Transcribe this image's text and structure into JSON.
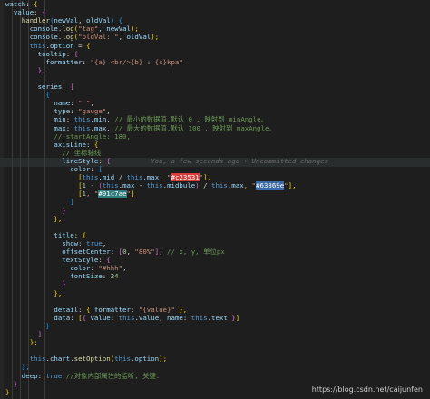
{
  "lines": [
    [
      [
        "watch",
        "tok-key"
      ],
      [
        ": ",
        "tok-plain"
      ],
      [
        "{",
        "tok-br"
      ]
    ],
    [
      [
        "  value",
        "tok-key"
      ],
      [
        ": ",
        "tok-plain"
      ],
      [
        "{",
        "tok-br2"
      ]
    ],
    [
      [
        "    handler",
        "tok-fn"
      ],
      [
        "(",
        "tok-br3"
      ],
      [
        "newVal",
        "tok-key"
      ],
      [
        ", ",
        "tok-plain"
      ],
      [
        "oldVal",
        "tok-key"
      ],
      [
        ") ",
        "tok-br3"
      ],
      [
        "{",
        "tok-br3"
      ]
    ],
    [
      [
        "      console",
        "tok-key"
      ],
      [
        ".",
        "tok-plain"
      ],
      [
        "log",
        "tok-fn"
      ],
      [
        "(",
        "tok-br"
      ],
      [
        "\"tag\"",
        "tok-str"
      ],
      [
        ", newVal",
        "tok-key"
      ],
      [
        ");",
        "tok-br"
      ]
    ],
    [
      [
        "      console",
        "tok-key"
      ],
      [
        ".",
        "tok-plain"
      ],
      [
        "log",
        "tok-fn"
      ],
      [
        "(",
        "tok-br"
      ],
      [
        "\"oldVal: \"",
        "tok-str"
      ],
      [
        ", oldVal",
        "tok-key"
      ],
      [
        ");",
        "tok-br"
      ]
    ],
    [
      [
        "      this",
        "tok-this"
      ],
      [
        ".",
        "tok-plain"
      ],
      [
        "option",
        "tok-key"
      ],
      [
        " = ",
        "tok-plain"
      ],
      [
        "{",
        "tok-br"
      ]
    ],
    [
      [
        "        tooltip",
        "tok-key"
      ],
      [
        ": ",
        "tok-plain"
      ],
      [
        "{",
        "tok-br2"
      ]
    ],
    [
      [
        "          formatter",
        "tok-key"
      ],
      [
        ": ",
        "tok-plain"
      ],
      [
        "\"{a} <br/>{b} : {c}kpa\"",
        "tok-str"
      ]
    ],
    [
      [
        "        },",
        "tok-br2"
      ]
    ],
    [
      [
        "",
        "tok-plain"
      ]
    ],
    [
      [
        "        series",
        "tok-key"
      ],
      [
        ": ",
        "tok-plain"
      ],
      [
        "[",
        "tok-br2"
      ]
    ],
    [
      [
        "          {",
        "tok-br3"
      ]
    ],
    [
      [
        "            name",
        "tok-key"
      ],
      [
        ": ",
        "tok-plain"
      ],
      [
        "\" \"",
        "tok-str"
      ],
      [
        ",",
        "tok-plain"
      ]
    ],
    [
      [
        "            type",
        "tok-key"
      ],
      [
        ": ",
        "tok-plain"
      ],
      [
        "\"gauge\"",
        "tok-str"
      ],
      [
        ",",
        "tok-plain"
      ]
    ],
    [
      [
        "            min",
        "tok-key"
      ],
      [
        ": ",
        "tok-plain"
      ],
      [
        "this",
        "tok-this"
      ],
      [
        ".",
        "tok-plain"
      ],
      [
        "min",
        "tok-key"
      ],
      [
        ", ",
        "tok-plain"
      ],
      [
        "// 最小的数据值,默认 0 . 映射到 minAngle。",
        "tok-cmt"
      ]
    ],
    [
      [
        "            max",
        "tok-key"
      ],
      [
        ": ",
        "tok-plain"
      ],
      [
        "this",
        "tok-this"
      ],
      [
        ".",
        "tok-plain"
      ],
      [
        "max",
        "tok-key"
      ],
      [
        ", ",
        "tok-plain"
      ],
      [
        "// 最大的数据值,默认 100 . 映射到 maxAngle。",
        "tok-cmt"
      ]
    ],
    [
      [
        "            //-startAngle: 180,",
        "tok-cmt"
      ]
    ],
    [
      [
        "            axisLine",
        "tok-key"
      ],
      [
        ": ",
        "tok-plain"
      ],
      [
        "{",
        "tok-br"
      ]
    ],
    [
      [
        "              // 坐标轴线",
        "tok-cmt"
      ]
    ],
    [
      [
        "              lineStyle",
        "tok-key"
      ],
      [
        ": ",
        "tok-plain"
      ],
      [
        "{",
        "tok-br2"
      ],
      [
        "          You, a few seconds ago • Uncommitted changes",
        "tok-ghost"
      ]
    ],
    [
      [
        "                color",
        "tok-key"
      ],
      [
        ": ",
        "tok-plain"
      ],
      [
        "[",
        "tok-br3"
      ]
    ],
    [
      [
        "                  [",
        "tok-br"
      ],
      [
        "this",
        "tok-this"
      ],
      [
        ".",
        "tok-plain"
      ],
      [
        "mid",
        "tok-key"
      ],
      [
        " / ",
        "tok-plain"
      ],
      [
        "this",
        "tok-this"
      ],
      [
        ".",
        "tok-plain"
      ],
      [
        "max",
        "tok-key"
      ],
      [
        ", \"",
        "tok-str"
      ],
      [
        "#c23531",
        "tok-red"
      ],
      [
        "\"",
        "tok-str"
      ],
      [
        "],",
        "tok-br"
      ]
    ],
    [
      [
        "                  [",
        "tok-br"
      ],
      [
        "1 - ",
        "tok-num"
      ],
      [
        "(",
        "tok-br2"
      ],
      [
        "this",
        "tok-this"
      ],
      [
        ".",
        "tok-plain"
      ],
      [
        "max",
        "tok-key"
      ],
      [
        " - ",
        "tok-plain"
      ],
      [
        "this",
        "tok-this"
      ],
      [
        ".",
        "tok-plain"
      ],
      [
        "midbule",
        "tok-key"
      ],
      [
        ")",
        "tok-br2"
      ],
      [
        " / ",
        "tok-plain"
      ],
      [
        "this",
        "tok-this"
      ],
      [
        ".",
        "tok-plain"
      ],
      [
        "max",
        "tok-key"
      ],
      [
        ", \"",
        "tok-str"
      ],
      [
        "#63869e",
        "tok-blue"
      ],
      [
        "\"",
        "tok-str"
      ],
      [
        "],",
        "tok-br"
      ]
    ],
    [
      [
        "                  [",
        "tok-br"
      ],
      [
        "1",
        "tok-num"
      ],
      [
        ", \"",
        "tok-str"
      ],
      [
        "#91c7ae",
        "tok-teal"
      ],
      [
        "\"",
        "tok-str"
      ],
      [
        "]",
        "tok-br"
      ]
    ],
    [
      [
        "                ]",
        "tok-br3"
      ]
    ],
    [
      [
        "              }",
        "tok-br2"
      ]
    ],
    [
      [
        "            },",
        "tok-br"
      ]
    ],
    [
      [
        "",
        "tok-plain"
      ]
    ],
    [
      [
        "            title",
        "tok-key"
      ],
      [
        ": ",
        "tok-plain"
      ],
      [
        "{",
        "tok-br"
      ]
    ],
    [
      [
        "              show",
        "tok-key"
      ],
      [
        ": ",
        "tok-plain"
      ],
      [
        "true",
        "tok-kw"
      ],
      [
        ",",
        "tok-plain"
      ]
    ],
    [
      [
        "              offsetCenter",
        "tok-key"
      ],
      [
        ": ",
        "tok-plain"
      ],
      [
        "[",
        "tok-br2"
      ],
      [
        "0",
        "tok-num"
      ],
      [
        ", ",
        "tok-plain"
      ],
      [
        "\"80%\"",
        "tok-str"
      ],
      [
        "]",
        "tok-br2"
      ],
      [
        ", ",
        "tok-plain"
      ],
      [
        "// x, y, 单位px",
        "tok-cmt"
      ]
    ],
    [
      [
        "              textStyle",
        "tok-key"
      ],
      [
        ": ",
        "tok-plain"
      ],
      [
        "{",
        "tok-br2"
      ]
    ],
    [
      [
        "                color",
        "tok-key"
      ],
      [
        ": ",
        "tok-plain"
      ],
      [
        "\"#hhh\"",
        "tok-str"
      ],
      [
        ",",
        "tok-plain"
      ]
    ],
    [
      [
        "                fontSize",
        "tok-key"
      ],
      [
        ": ",
        "tok-plain"
      ],
      [
        "24",
        "tok-num"
      ]
    ],
    [
      [
        "              }",
        "tok-br2"
      ]
    ],
    [
      [
        "            },",
        "tok-br"
      ]
    ],
    [
      [
        "",
        "tok-plain"
      ]
    ],
    [
      [
        "            detail",
        "tok-key"
      ],
      [
        ": ",
        "tok-plain"
      ],
      [
        "{",
        "tok-br"
      ],
      [
        " formatter",
        "tok-key"
      ],
      [
        ": ",
        "tok-plain"
      ],
      [
        "\"{value}\"",
        "tok-str"
      ],
      [
        " },",
        "tok-br"
      ]
    ],
    [
      [
        "            data",
        "tok-key"
      ],
      [
        ": ",
        "tok-plain"
      ],
      [
        "[",
        "tok-br"
      ],
      [
        "{",
        "tok-br2"
      ],
      [
        " value",
        "tok-key"
      ],
      [
        ": ",
        "tok-plain"
      ],
      [
        "this",
        "tok-this"
      ],
      [
        ".",
        "tok-plain"
      ],
      [
        "value",
        "tok-key"
      ],
      [
        ", ",
        "tok-plain"
      ],
      [
        "name",
        "tok-key"
      ],
      [
        ": ",
        "tok-plain"
      ],
      [
        "this",
        "tok-this"
      ],
      [
        ".",
        "tok-plain"
      ],
      [
        "text",
        "tok-key"
      ],
      [
        " }",
        "tok-br2"
      ],
      [
        "]",
        "tok-br"
      ]
    ],
    [
      [
        "          }",
        "tok-br3"
      ]
    ],
    [
      [
        "        ]",
        "tok-br2"
      ]
    ],
    [
      [
        "      };",
        "tok-br"
      ]
    ],
    [
      [
        "",
        "tok-plain"
      ]
    ],
    [
      [
        "      this",
        "tok-this"
      ],
      [
        ".",
        "tok-plain"
      ],
      [
        "chart",
        "tok-key"
      ],
      [
        ".",
        "tok-plain"
      ],
      [
        "setOption",
        "tok-fn"
      ],
      [
        "(",
        "tok-br"
      ],
      [
        "this",
        "tok-this"
      ],
      [
        ".",
        "tok-plain"
      ],
      [
        "option",
        "tok-key"
      ],
      [
        ");",
        "tok-br"
      ]
    ],
    [
      [
        "    },",
        "tok-br3"
      ]
    ],
    [
      [
        "    deep",
        "tok-key"
      ],
      [
        ": ",
        "tok-plain"
      ],
      [
        "true",
        "tok-kw"
      ],
      [
        " ",
        "tok-plain"
      ],
      [
        "//对象内部属性的监听, 关键.",
        "tok-cmt"
      ]
    ],
    [
      [
        "  }",
        "tok-br2"
      ]
    ],
    [
      [
        "}",
        "tok-br"
      ]
    ]
  ],
  "watermark": "https://blog.csdn.net/caijunfen"
}
